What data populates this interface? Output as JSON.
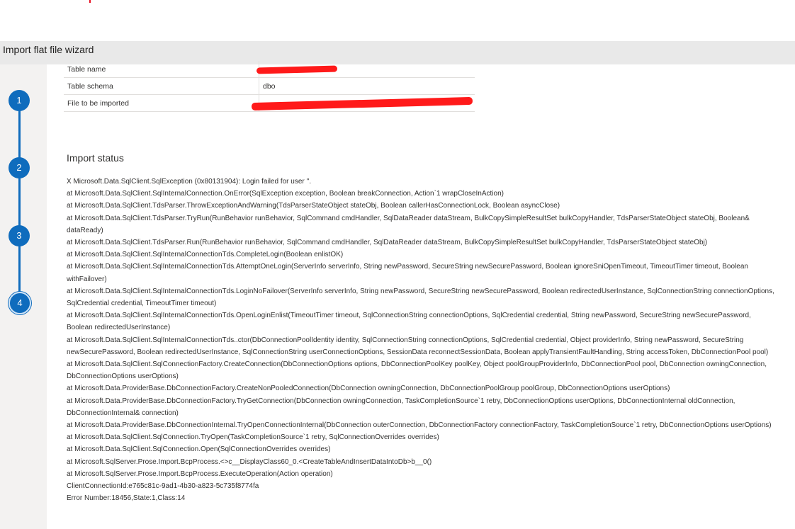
{
  "window": {
    "title": "Import flat file wizard"
  },
  "steps": [
    {
      "label": "1"
    },
    {
      "label": "2"
    },
    {
      "label": "3"
    },
    {
      "label": "4"
    }
  ],
  "summary": {
    "rows": [
      {
        "label": "Table name",
        "value": ""
      },
      {
        "label": "Table schema",
        "value": "dbo"
      },
      {
        "label": "File to be imported",
        "value": ""
      }
    ]
  },
  "status": {
    "heading": "Import status",
    "lines": [
      "X  Microsoft.Data.SqlClient.SqlException (0x80131904): Login failed for user ''.",
      "at Microsoft.Data.SqlClient.SqlInternalConnection.OnError(SqlException exception, Boolean breakConnection, Action`1 wrapCloseInAction)",
      "at Microsoft.Data.SqlClient.TdsParser.ThrowExceptionAndWarning(TdsParserStateObject stateObj, Boolean callerHasConnectionLock, Boolean asyncClose)",
      "at Microsoft.Data.SqlClient.TdsParser.TryRun(RunBehavior runBehavior, SqlCommand cmdHandler, SqlDataReader dataStream, BulkCopySimpleResultSet bulkCopyHandler, TdsParserStateObject stateObj, Boolean& dataReady)",
      "at Microsoft.Data.SqlClient.TdsParser.Run(RunBehavior runBehavior, SqlCommand cmdHandler, SqlDataReader dataStream, BulkCopySimpleResultSet bulkCopyHandler, TdsParserStateObject stateObj)",
      "at Microsoft.Data.SqlClient.SqlInternalConnectionTds.CompleteLogin(Boolean enlistOK)",
      "at Microsoft.Data.SqlClient.SqlInternalConnectionTds.AttemptOneLogin(ServerInfo serverInfo, String newPassword, SecureString newSecurePassword, Boolean ignoreSniOpenTimeout, TimeoutTimer timeout, Boolean withFailover)",
      "at Microsoft.Data.SqlClient.SqlInternalConnectionTds.LoginNoFailover(ServerInfo serverInfo, String newPassword, SecureString newSecurePassword, Boolean redirectedUserInstance, SqlConnectionString connectionOptions, SqlCredential credential, TimeoutTimer timeout)",
      "at Microsoft.Data.SqlClient.SqlInternalConnectionTds.OpenLoginEnlist(TimeoutTimer timeout, SqlConnectionString connectionOptions, SqlCredential credential, String newPassword, SecureString newSecurePassword, Boolean redirectedUserInstance)",
      "at Microsoft.Data.SqlClient.SqlInternalConnectionTds..ctor(DbConnectionPoolIdentity identity, SqlConnectionString connectionOptions, SqlCredential credential, Object providerInfo, String newPassword, SecureString newSecurePassword, Boolean redirectedUserInstance, SqlConnectionString userConnectionOptions, SessionData reconnectSessionData, Boolean applyTransientFaultHandling, String accessToken, DbConnectionPool pool)",
      "at Microsoft.Data.SqlClient.SqlConnectionFactory.CreateConnection(DbConnectionOptions options, DbConnectionPoolKey poolKey, Object poolGroupProviderInfo, DbConnectionPool pool, DbConnection owningConnection, DbConnectionOptions userOptions)",
      "at Microsoft.Data.ProviderBase.DbConnectionFactory.CreateNonPooledConnection(DbConnection owningConnection, DbConnectionPoolGroup poolGroup, DbConnectionOptions userOptions)",
      "at Microsoft.Data.ProviderBase.DbConnectionFactory.TryGetConnection(DbConnection owningConnection, TaskCompletionSource`1 retry, DbConnectionOptions userOptions, DbConnectionInternal oldConnection, DbConnectionInternal& connection)",
      "at Microsoft.Data.ProviderBase.DbConnectionInternal.TryOpenConnectionInternal(DbConnection outerConnection, DbConnectionFactory connectionFactory, TaskCompletionSource`1 retry, DbConnectionOptions userOptions)",
      "at Microsoft.Data.SqlClient.SqlConnection.TryOpen(TaskCompletionSource`1 retry, SqlConnectionOverrides overrides)",
      "at Microsoft.Data.SqlClient.SqlConnection.Open(SqlConnectionOverrides overrides)",
      "at Microsoft.SqlServer.Prose.Import.BcpProcess.<>c__DisplayClass60_0.<CreateTableAndInsertDataIntoDb>b__0()",
      "at Microsoft.SqlServer.Prose.Import.BcpProcess.ExecuteOperation(Action operation)",
      "ClientConnectionId:e765c81c-9ad1-4b30-a823-5c735f8774fa",
      "Error Number:18456,State:1,Class:14"
    ]
  },
  "colors": {
    "accent": "#0f6cbd",
    "redaction": "#ff1a1a"
  }
}
